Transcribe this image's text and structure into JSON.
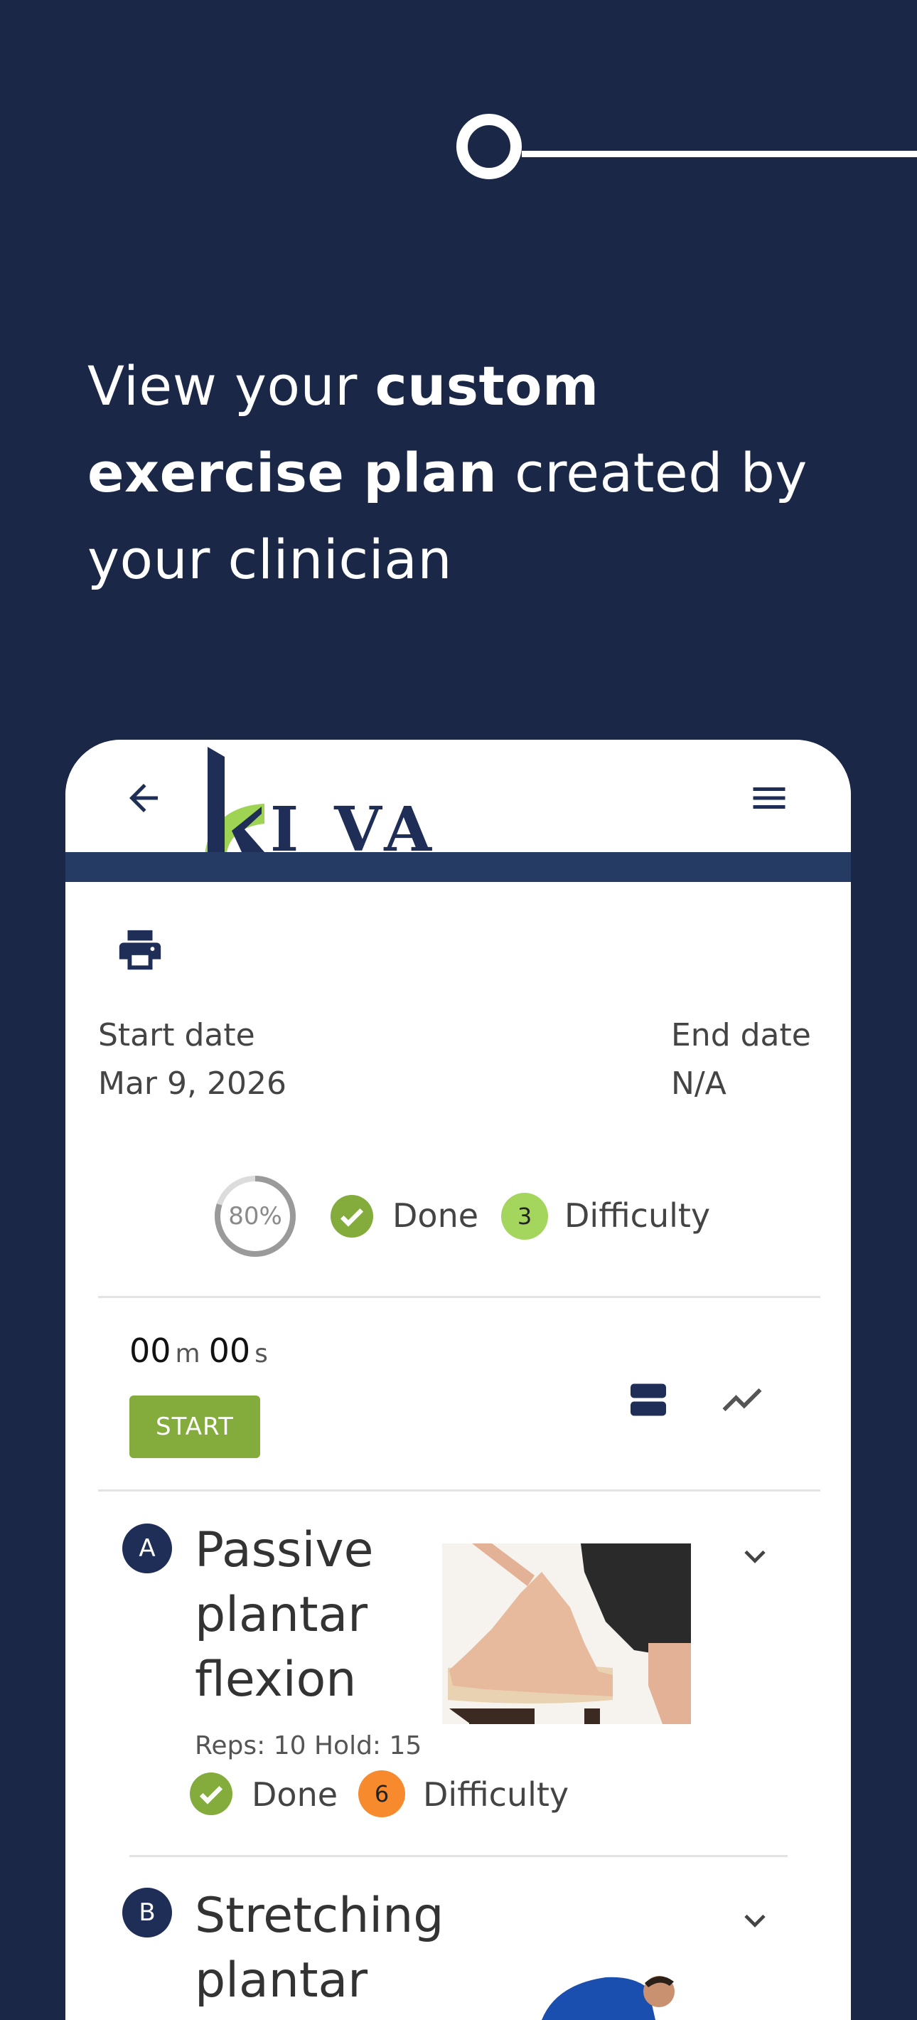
{
  "onboarding": {
    "headline_parts": [
      "View your ",
      "custom exercise plan",
      " created by your clinician"
    ]
  },
  "app": {
    "brand": "KIVA",
    "icons": [
      "back-arrow-icon",
      "hamburger-menu-icon",
      "printer-icon",
      "list-view-icon",
      "trend-chart-icon",
      "chevron-down-icon",
      "check-circle-icon"
    ]
  },
  "plan": {
    "start_label": "Start date",
    "start_value": "Mar 9, 2026",
    "end_label": "End date",
    "end_value": "N/A",
    "progress_text": "80%",
    "progress_fraction": 0.8,
    "done_label": "Done",
    "difficulty_value": "3",
    "difficulty_label": "Difficulty"
  },
  "timer": {
    "minutes": "00",
    "minutes_unit": "m",
    "seconds": "00",
    "seconds_unit": "s",
    "start_label": "START"
  },
  "exercises": [
    {
      "letter": "A",
      "title": "Passive plantar flexion",
      "meta": "Reps: 10 Hold: 15",
      "done_label": "Done",
      "difficulty_value": "6",
      "difficulty_label": "Difficulty"
    },
    {
      "letter": "B",
      "title": "Stretching plantar"
    }
  ],
  "colors": {
    "background": "#1a2747",
    "app_stripe": "#253b64",
    "done_green": "#84ac3c",
    "difficulty_low": "#a4d65e",
    "difficulty_high": "#f78a2c",
    "logo_green": "#9ed354"
  }
}
